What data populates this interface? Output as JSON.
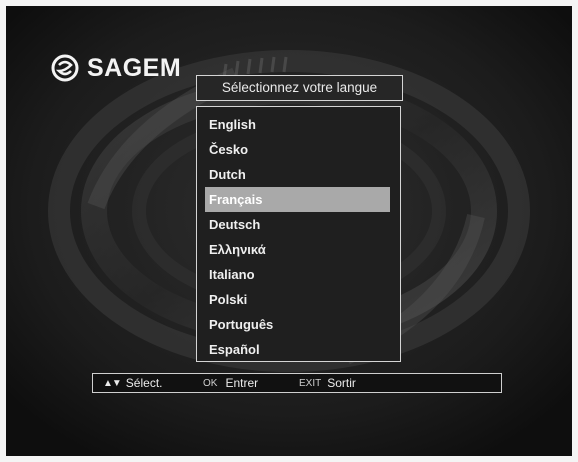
{
  "brand": {
    "name": "SAGEM"
  },
  "menu": {
    "title": "Sélectionnez votre langue",
    "selected_index": 3,
    "items": [
      {
        "label": "English"
      },
      {
        "label": "Česko"
      },
      {
        "label": "Dutch"
      },
      {
        "label": "Français"
      },
      {
        "label": "Deutsch"
      },
      {
        "label": "Ελληνικά"
      },
      {
        "label": "Italiano"
      },
      {
        "label": "Polski"
      },
      {
        "label": "Português"
      },
      {
        "label": "Español"
      }
    ]
  },
  "footer": {
    "select_key": "▲▼",
    "select_label": "Sélect.",
    "ok_key": "OK",
    "ok_label": "Entrer",
    "exit_key": "EXIT",
    "exit_label": "Sortir"
  },
  "colors": {
    "background": "#1b1b1b",
    "highlight": "#a9a9a9",
    "border": "#d5d5d5",
    "text": "#efefef"
  }
}
